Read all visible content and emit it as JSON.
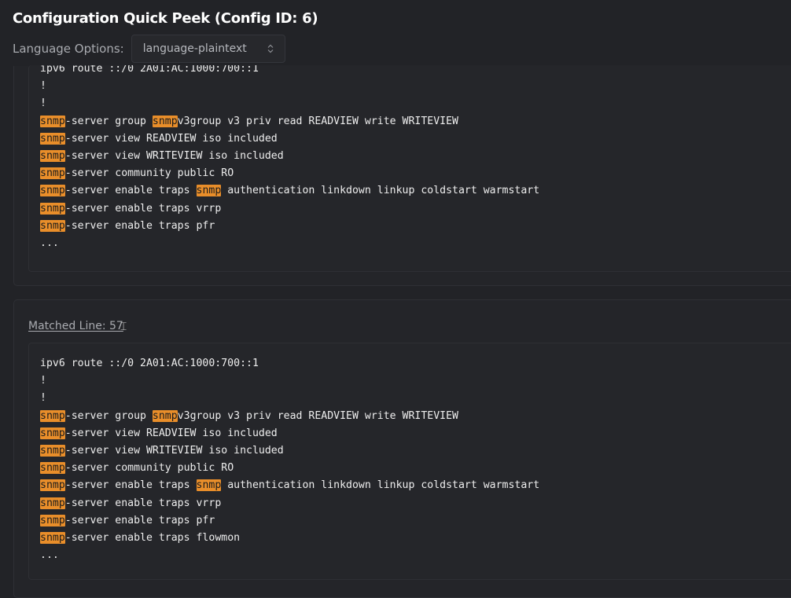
{
  "header": {
    "title": "Configuration Quick Peek (Config ID: 6)",
    "language_label": "Language Options:",
    "language_value": "language-plaintext"
  },
  "icons": {
    "select_chevron": "chevron-updown-icon",
    "cursor": "text-cursor-icon"
  },
  "colors": {
    "background": "#222327",
    "highlight": "#e98e2a"
  },
  "result1": {
    "lines": [
      [
        {
          "t": "ipv6 route ::/0 2A01:AC:1000:700::1"
        }
      ],
      [
        {
          "t": "!"
        }
      ],
      [
        {
          "t": "!"
        }
      ],
      [
        {
          "t": "snmp",
          "h": true
        },
        {
          "t": "-server group "
        },
        {
          "t": "snmp",
          "h": true
        },
        {
          "t": "v3group v3 priv read READVIEW write WRITEVIEW"
        }
      ],
      [
        {
          "t": "snmp",
          "h": true
        },
        {
          "t": "-server view READVIEW iso included"
        }
      ],
      [
        {
          "t": "snmp",
          "h": true
        },
        {
          "t": "-server view WRITEVIEW iso included"
        }
      ],
      [
        {
          "t": "snmp",
          "h": true
        },
        {
          "t": "-server community public RO"
        }
      ],
      [
        {
          "t": "snmp",
          "h": true
        },
        {
          "t": "-server enable traps "
        },
        {
          "t": "snmp",
          "h": true
        },
        {
          "t": " authentication linkdown linkup coldstart warmstart"
        }
      ],
      [
        {
          "t": "snmp",
          "h": true
        },
        {
          "t": "-server enable traps vrrp"
        }
      ],
      [
        {
          "t": "snmp",
          "h": true
        },
        {
          "t": "-server enable traps pfr"
        }
      ],
      [
        {
          "t": "..."
        }
      ]
    ]
  },
  "result2": {
    "matched_label": "Matched Line: 57",
    "lines": [
      [
        {
          "t": "ipv6 route ::/0 2A01:AC:1000:700::1"
        }
      ],
      [
        {
          "t": "!"
        }
      ],
      [
        {
          "t": "!"
        }
      ],
      [
        {
          "t": "snmp",
          "h": true
        },
        {
          "t": "-server group "
        },
        {
          "t": "snmp",
          "h": true
        },
        {
          "t": "v3group v3 priv read READVIEW write WRITEVIEW"
        }
      ],
      [
        {
          "t": "snmp",
          "h": true
        },
        {
          "t": "-server view READVIEW iso included"
        }
      ],
      [
        {
          "t": "snmp",
          "h": true
        },
        {
          "t": "-server view WRITEVIEW iso included"
        }
      ],
      [
        {
          "t": "snmp",
          "h": true
        },
        {
          "t": "-server community public RO"
        }
      ],
      [
        {
          "t": "snmp",
          "h": true
        },
        {
          "t": "-server enable traps "
        },
        {
          "t": "snmp",
          "h": true
        },
        {
          "t": " authentication linkdown linkup coldstart warmstart"
        }
      ],
      [
        {
          "t": "snmp",
          "h": true
        },
        {
          "t": "-server enable traps vrrp"
        }
      ],
      [
        {
          "t": "snmp",
          "h": true
        },
        {
          "t": "-server enable traps pfr"
        }
      ],
      [
        {
          "t": "snmp",
          "h": true
        },
        {
          "t": "-server enable traps flowmon"
        }
      ],
      [
        {
          "t": "..."
        }
      ]
    ]
  }
}
